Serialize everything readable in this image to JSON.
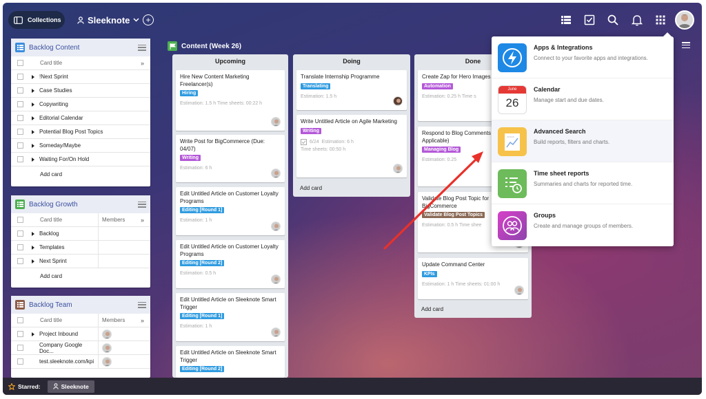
{
  "topbar": {
    "collections_label": "Collections",
    "workspace_name": "Sleeknote",
    "icons": [
      "list-view-icon",
      "checkbox-icon",
      "search-icon",
      "bell-icon",
      "apps-grid-icon"
    ]
  },
  "backlog_content": {
    "title": "Backlog Content",
    "header_card_title": "Card title",
    "rows": [
      "!Next Sprint",
      "Case Studies",
      "Copywriting",
      "Editorial Calendar",
      "Potential Blog Post Topics",
      "Someday/Maybe",
      "Waiting For/On Hold"
    ],
    "add_card": "Add card",
    "color": "#3b8de0"
  },
  "backlog_growth": {
    "title": "Backlog Growth",
    "header_card_title": "Card title",
    "header_members": "Members",
    "rows": [
      "Backlog",
      "Templates",
      "Next Sprint"
    ],
    "add_card": "Add card",
    "color": "#4caf50"
  },
  "backlog_team": {
    "title": "Backlog Team",
    "header_card_title": "Card title",
    "header_members": "Members",
    "rows": [
      "Project Inbound",
      "Company Google Doc...",
      "test.sleeknote.com/kpi"
    ],
    "color": "#8d5a48"
  },
  "board": {
    "title": "Content (Week 26)",
    "columns": {
      "upcoming": {
        "title": "Upcoming",
        "cards": [
          {
            "title": "Hire New Content Marketing Freelancer(s)",
            "label": "Hiring",
            "meta": "Estimation: 1.5 h   Time sheets: 00:22 h"
          },
          {
            "title": "Write Post for BigCommerce (Due: 04/07)",
            "label": "Writing",
            "meta": "Estimation: 6 h"
          },
          {
            "title": "Edit Untitled Article on Customer Loyalty Programs",
            "label": "Editing [Round 1]",
            "meta": "Estimation: 1 h"
          },
          {
            "title": "Edit Untitled Article on Customer Loyalty Programs",
            "label": "Editing [Round 2]",
            "meta": "Estimation: 0.5 h"
          },
          {
            "title": "Edit Untitled Article on Sleeknote Smart Trigger",
            "label": "Editing [Round 1]",
            "meta": "Estimation: 1 h"
          },
          {
            "title": "Edit Untitled Article on Sleeknote Smart Trigger",
            "label": "Editing [Round 2]",
            "meta": ""
          }
        ]
      },
      "doing": {
        "title": "Doing",
        "cards": [
          {
            "title": "Translate Internship Programme",
            "label": "Translating",
            "meta": "Estimation: 1.5 h"
          },
          {
            "title": "Write Untitled Article on Agile Marketing",
            "label": "Writing",
            "checklist": "6/24",
            "meta": "Estimation: 6 h",
            "meta2": "Time sheets: 00:50 h"
          }
        ],
        "add_card": "Add card"
      },
      "done": {
        "title": "Done",
        "cards": [
          {
            "title": "Create Zap for Hero Images",
            "label": "Automation",
            "meta": "Estimation: 0.25 h   Time s"
          },
          {
            "title": "Respond to Blog Comments (If Applicable)",
            "label": "Managing Blog",
            "meta": "Estimation: 0.25"
          },
          {
            "title": "Validate Blog Post Topic for BigCommerce",
            "label": "Validate Blog Post Topics",
            "meta": "Estimation: 0.5 h   Time shee"
          },
          {
            "title": "Update Command Center",
            "label": "KPIs",
            "meta": "Estimation: 1 h   Time sheets: 01:00 h"
          }
        ],
        "add_card": "Add card"
      }
    }
  },
  "dropdown": {
    "items": [
      {
        "title": "Apps & Integrations",
        "desc": "Connect to your favorite apps and integrations."
      },
      {
        "title": "Calendar",
        "desc": "Manage start and due dates.",
        "month": "June",
        "day": "26"
      },
      {
        "title": "Advanced Search",
        "desc": "Build reports, filters and charts."
      },
      {
        "title": "Time sheet reports",
        "desc": "Summaries and charts for reported time."
      },
      {
        "title": "Groups",
        "desc": "Create and manage groups of members."
      }
    ]
  },
  "starbar": {
    "label": "Starred:",
    "chip": "Sleeknote"
  },
  "colors": {
    "hiring": "#2f9be0",
    "writing": "#b458d8",
    "editing": "#2f9be0",
    "translating": "#2f9be0",
    "automation": "#b458d8",
    "managing_blog": "#b458d8",
    "validate": "#8a6a55",
    "kpis": "#2f9be0",
    "arrow": "#e8312a"
  }
}
